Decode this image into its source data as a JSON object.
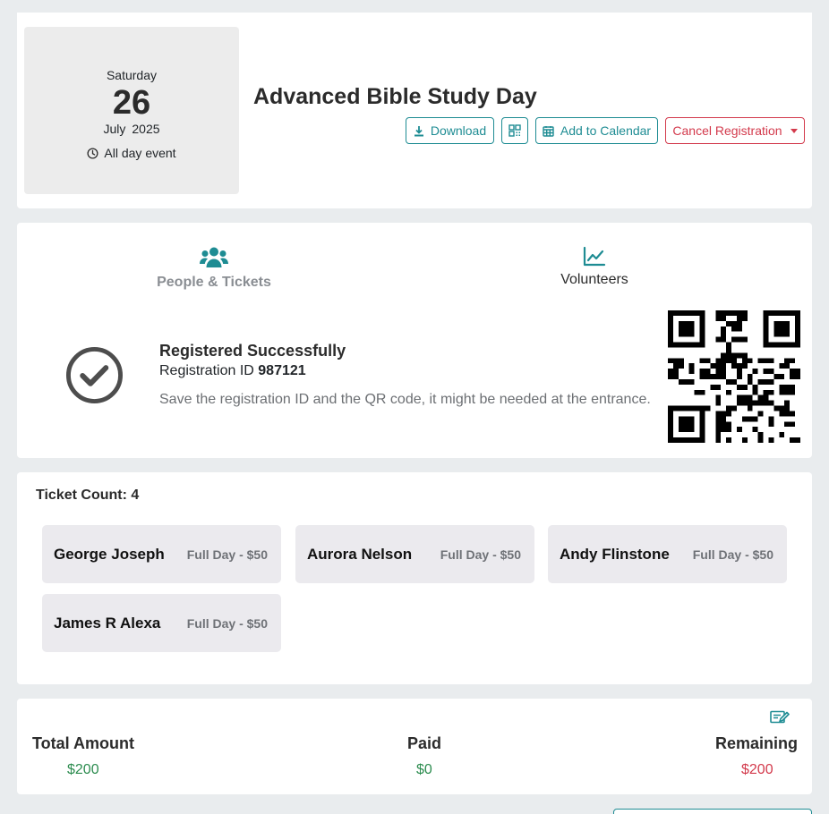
{
  "event": {
    "weekday": "Saturday",
    "day": "26",
    "month": "July",
    "year": "2025",
    "all_day": "All day event",
    "title": "Advanced Bible Study Day"
  },
  "actions": {
    "download": "Download",
    "add_to_calendar": "Add to Calendar",
    "cancel_registration": "Cancel Registration"
  },
  "tabs": {
    "people": "People & Tickets",
    "volunteers": "Volunteers"
  },
  "registration": {
    "title": "Registered Successfully",
    "id_label": "Registration ID",
    "id": "987121",
    "note": "Save the registration ID and the QR code, it might be needed at the entrance."
  },
  "tickets": {
    "count_label": "Ticket Count: 4",
    "items": [
      {
        "name": "George Joseph",
        "price": "Full Day - $50"
      },
      {
        "name": "Aurora Nelson",
        "price": "Full Day - $50"
      },
      {
        "name": "Andy Flinstone",
        "price": "Full Day - $50"
      },
      {
        "name": "James R Alexa",
        "price": "Full Day - $50"
      }
    ]
  },
  "payment": {
    "total_label": "Total Amount",
    "total": "$200",
    "paid_label": "Paid",
    "paid": "$0",
    "remaining_label": "Remaining",
    "remaining": "$200"
  },
  "colors": {
    "accent": "#1e8c93",
    "danger": "#d33a4c",
    "success": "#2c8c4f"
  },
  "icons": [
    "clock-icon",
    "download-icon",
    "qr-code-icon",
    "calendar-icon",
    "users-icon",
    "chart-line-icon",
    "check-circle-icon",
    "edit-icon"
  ]
}
